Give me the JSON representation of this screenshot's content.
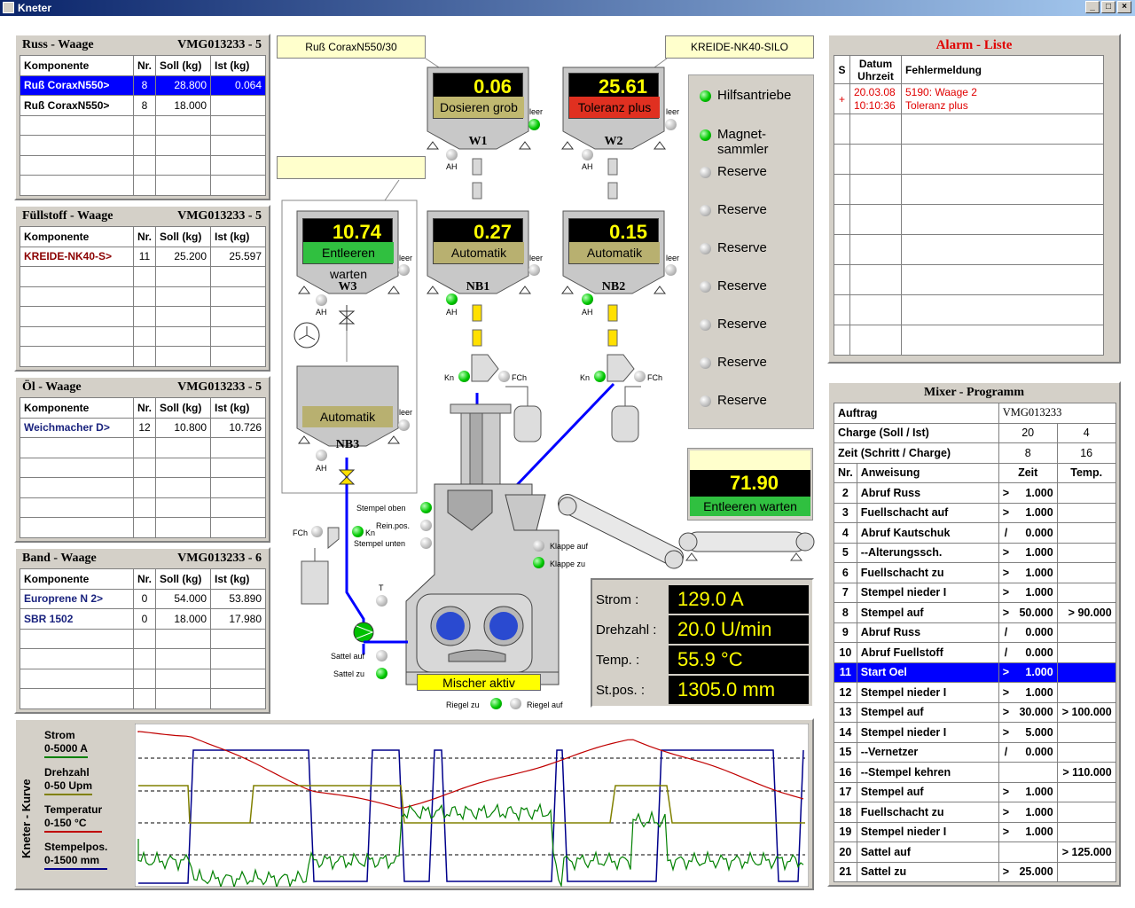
{
  "window": {
    "title": "Kneter",
    "min_label": "_",
    "max_label": "□",
    "close_label": "×"
  },
  "russ": {
    "title": "Russ - Waage",
    "id": "VMG013233 - 5",
    "headers": [
      "Komponente",
      "Nr.",
      "Soll (kg)",
      "Ist (kg)"
    ],
    "rows": [
      [
        "Ruß CoraxN550>",
        "8",
        "28.800",
        "0.064"
      ],
      [
        "Ruß CoraxN550>",
        "8",
        "18.000",
        ""
      ]
    ]
  },
  "fuell": {
    "title": "Füllstoff - Waage",
    "id": "VMG013233 - 5",
    "headers": [
      "Komponente",
      "Nr.",
      "Soll (kg)",
      "Ist (kg)"
    ],
    "rows": [
      [
        "KREIDE-NK40-S>",
        "11",
        "25.200",
        "25.597"
      ]
    ]
  },
  "oel": {
    "title": "Öl - Waage",
    "id": "VMG013233 - 5",
    "headers": [
      "Komponente",
      "Nr.",
      "Soll (kg)",
      "Ist (kg)"
    ],
    "rows": [
      [
        "Weichmacher D>",
        "12",
        "10.800",
        "10.726"
      ]
    ]
  },
  "band": {
    "title": "Band - Waage",
    "id": "VMG013233 - 6",
    "headers": [
      "Komponente",
      "Nr.",
      "Soll (kg)",
      "Ist (kg)"
    ],
    "rows": [
      [
        "Europrene N 2>",
        "0",
        "54.000",
        "53.890"
      ],
      [
        "SBR 1502",
        "0",
        "18.000",
        "17.980"
      ]
    ]
  },
  "labels": {
    "russ_silo": "Ruß CoraxN550/30",
    "kreide_silo": "KREIDE-NK40-SILO",
    "w3_label": ""
  },
  "hoppers": {
    "w1": {
      "value": "0.06",
      "status": "Dosieren grob",
      "name": "W1",
      "status_color": "#c0b870"
    },
    "w2": {
      "value": "25.61",
      "status": "Toleranz plus",
      "name": "W2",
      "status_color": "#e03020"
    },
    "w3": {
      "value": "10.74",
      "status": "Entleeren warten",
      "name": "W3",
      "status_color": "#30c040"
    },
    "nb1": {
      "value": "0.27",
      "status": "Automatik",
      "name": "NB1",
      "status_color": "#b8b070"
    },
    "nb2": {
      "value": "0.15",
      "status": "Automatik",
      "name": "NB2",
      "status_color": "#b8b070"
    },
    "nb3": {
      "status": "Automatik",
      "name": "NB3",
      "status_color": "#b8b070"
    }
  },
  "small": {
    "leer": "leer",
    "ah": "AH",
    "kn": "Kn",
    "fch": "FCh",
    "t": "T",
    "stempel_oben": "Stempel oben",
    "rein_pos": "Rein.pos.",
    "stempel_unten": "Stempel unten",
    "klappe_auf": "Klappe auf",
    "klappe_zu": "Klappe zu",
    "sattel_auf": "Sattel auf",
    "sattel_zu": "Sattel zu",
    "riegel_zu": "Riegel zu",
    "riegel_auf": "Riegel auf",
    "mischer": "Mischer aktiv"
  },
  "leds": [
    {
      "label": "Hilfsantriebe",
      "on": true
    },
    {
      "label": "Magnet-\nsammler",
      "on": true
    },
    {
      "label": "Reserve",
      "on": false
    },
    {
      "label": "Reserve",
      "on": false
    },
    {
      "label": "Reserve",
      "on": false
    },
    {
      "label": "Reserve",
      "on": false
    },
    {
      "label": "Reserve",
      "on": false
    },
    {
      "label": "Reserve",
      "on": false
    },
    {
      "label": "Reserve",
      "on": false
    }
  ],
  "bigdisplay": {
    "top": "",
    "value": "71.90",
    "status": "Entleeren warten"
  },
  "measures": [
    {
      "label": "Strom :",
      "value": "129.0 A"
    },
    {
      "label": "Drehzahl :",
      "value": "20.0 U/min"
    },
    {
      "label": "Temp. :",
      "value": "55.9 °C"
    },
    {
      "label": "St.pos. :",
      "value": "1305.0 mm"
    }
  ],
  "alarm": {
    "title": "Alarm - Liste",
    "headers": [
      "S",
      "Datum\nUhrzeit",
      "Fehlermeldung"
    ],
    "rows": [
      {
        "s": "+",
        "date": "20.03.08",
        "time": "10:10:36",
        "msg1": "5190: Waage 2",
        "msg2": "Toleranz plus"
      }
    ]
  },
  "mixer": {
    "title": "Mixer - Programm",
    "auftrag_label": "Auftrag",
    "auftrag": "VMG013233",
    "charge_label": "Charge (Soll / Ist)",
    "charge_soll": "20",
    "charge_ist": "4",
    "zeit_label": "Zeit (Schritt / Charge)",
    "zeit_schritt": "8",
    "zeit_charge": "16",
    "headers": [
      "Nr.",
      "Anweisung",
      "Zeit",
      "Temp."
    ],
    "steps": [
      [
        "2",
        "Abruf Russ",
        ">",
        "1.000",
        ""
      ],
      [
        "3",
        "Fuellschacht auf",
        ">",
        "1.000",
        ""
      ],
      [
        "4",
        "Abruf Kautschuk",
        "/",
        "0.000",
        ""
      ],
      [
        "5",
        "--Alterungssch.",
        ">",
        "1.000",
        ""
      ],
      [
        "6",
        "Fuellschacht zu",
        ">",
        "1.000",
        ""
      ],
      [
        "7",
        "Stempel nieder I",
        ">",
        "1.000",
        ""
      ],
      [
        "8",
        "Stempel auf",
        ">",
        "50.000",
        "> 90.000"
      ],
      [
        "9",
        "Abruf Russ",
        "/",
        "0.000",
        ""
      ],
      [
        "10",
        "Abruf Fuellstoff",
        "/",
        "0.000",
        ""
      ],
      [
        "11",
        "Start Oel",
        ">",
        "1.000",
        ""
      ],
      [
        "12",
        "Stempel nieder I",
        ">",
        "1.000",
        ""
      ],
      [
        "13",
        "Stempel auf",
        ">",
        "30.000",
        "> 100.000"
      ],
      [
        "14",
        "Stempel nieder I",
        ">",
        "5.000",
        ""
      ],
      [
        "15",
        "--Vernetzer",
        "/",
        "0.000",
        ""
      ],
      [
        "16",
        "--Stempel kehren",
        "",
        "",
        "> 110.000"
      ],
      [
        "17",
        "Stempel auf",
        ">",
        "1.000",
        ""
      ],
      [
        "18",
        "Fuellschacht zu",
        ">",
        "1.000",
        ""
      ],
      [
        "19",
        "Stempel nieder I",
        ">",
        "1.000",
        ""
      ],
      [
        "20",
        "Sattel auf",
        "",
        "",
        "> 125.000"
      ],
      [
        "21",
        "Sattel zu",
        ">",
        "25.000",
        ""
      ]
    ],
    "selected": "11"
  },
  "chart": {
    "vertical_title": "Kneter - Kurve",
    "legend": [
      {
        "name": "Strom",
        "range": "0-5000 A",
        "color": "#008000"
      },
      {
        "name": "Drehzahl",
        "range": "0-50 Upm",
        "color": "#808000"
      },
      {
        "name": "Temperatur",
        "range": "0-150 °C",
        "color": "#c00000"
      },
      {
        "name": "Stempelpos.",
        "range": "0-1500 mm",
        "color": "#00008b"
      }
    ]
  }
}
